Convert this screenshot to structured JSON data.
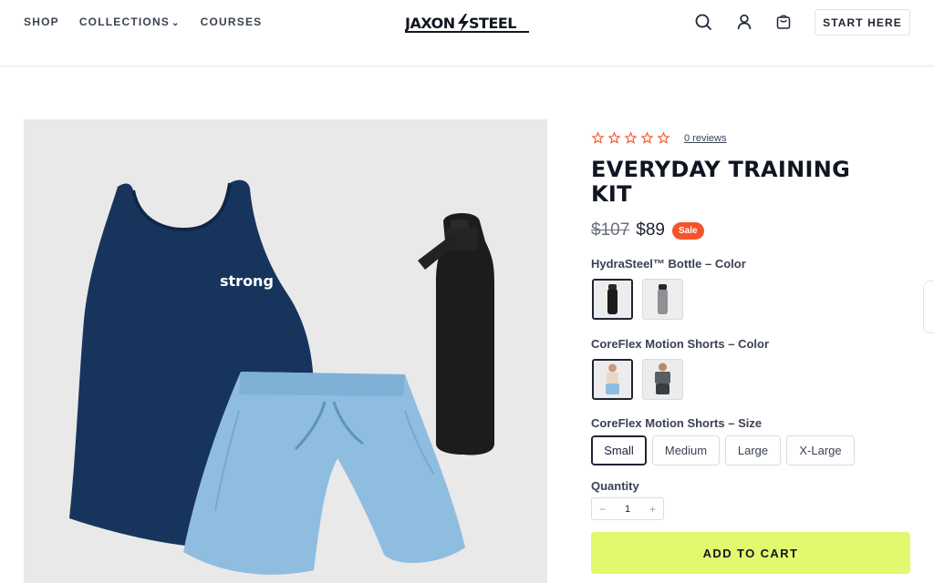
{
  "header": {
    "nav": [
      {
        "label": "SHOP"
      },
      {
        "label": "COLLECTIONS"
      },
      {
        "label": "COURSES"
      }
    ],
    "logo_text": "JAXON STEEL",
    "icons": [
      "search-icon",
      "account-icon",
      "cart-icon"
    ],
    "cta_label": "START HERE"
  },
  "product": {
    "image_text": "strong",
    "rating": {
      "stars": 0,
      "max": 5,
      "reviews_label": "0 reviews",
      "star_color": "#f2542d"
    },
    "title": "EVERYDAY TRAINING KIT",
    "price": {
      "old": "$107",
      "current": "$89",
      "badge": "Sale",
      "badge_color": "#f2542d"
    },
    "options": {
      "bottle_color_label": "HydraSteel™ Bottle – Color",
      "bottle_colors": [
        "Black",
        "Silver"
      ],
      "bottle_selected": "Black",
      "shorts_color_label": "CoreFlex Motion Shorts – Color",
      "shorts_colors": [
        "Light Blue",
        "Charcoal"
      ],
      "shorts_color_selected": "Light Blue",
      "shorts_size_label": "CoreFlex Motion Shorts – Size",
      "sizes": [
        "Small",
        "Medium",
        "Large",
        "X-Large"
      ],
      "size_selected": "Small"
    },
    "quantity_label": "Quantity",
    "quantity": "1",
    "qty_minus": "−",
    "qty_plus": "+",
    "add_to_cart": "ADD TO CART",
    "cta_color": "#e1f96e"
  }
}
